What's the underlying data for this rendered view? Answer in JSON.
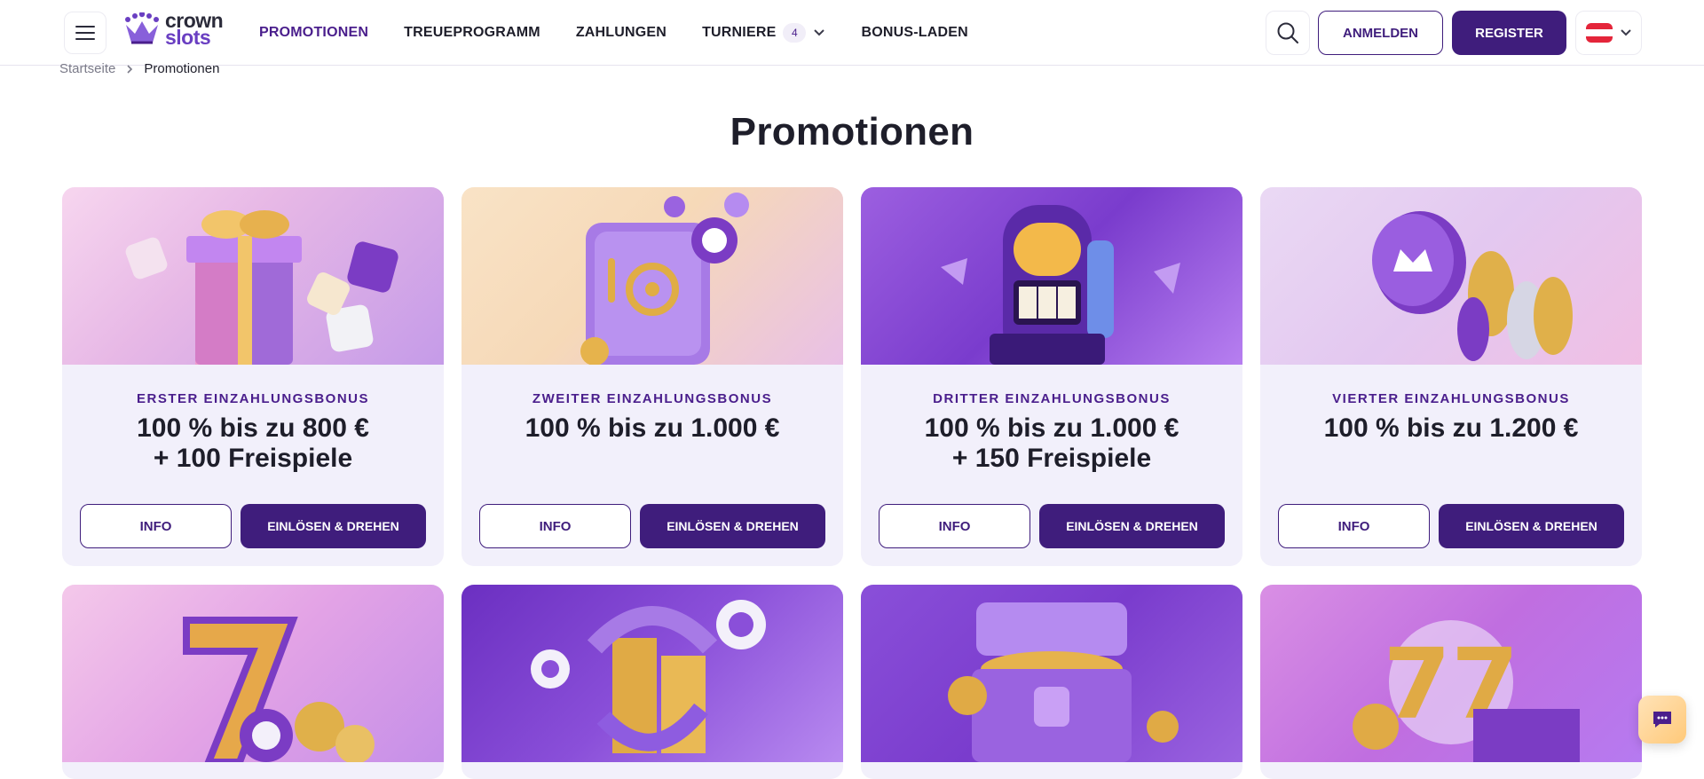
{
  "header": {
    "menu_icon": "hamburger-icon",
    "logo": {
      "line1": "crown",
      "line2": "slots"
    },
    "nav": [
      {
        "label": "PROMOTIONEN",
        "active": true
      },
      {
        "label": "TREUEPROGRAMM"
      },
      {
        "label": "ZAHLUNGEN"
      },
      {
        "label": "TURNIERE",
        "badge": "4"
      },
      {
        "label": "BONUS-LADEN"
      }
    ],
    "search_icon": "search-icon",
    "login_label": "ANMELDEN",
    "register_label": "REGISTER",
    "language_flag": "austria-flag-icon"
  },
  "breadcrumb": {
    "home": "Startseite",
    "current": "Promotionen"
  },
  "page_title": "Promotionen",
  "promotions": [
    {
      "title": "ERSTER EINZAHLUNGSBONUS",
      "offer_line1": "100 % bis zu 800 €",
      "offer_line2": "+ 100 Freispiele",
      "info_label": "INFO",
      "redeem_label": "EINLÖSEN & DREHEN",
      "image": "gift-box-dice"
    },
    {
      "title": "ZWEITER EINZAHLUNGSBONUS",
      "offer_line1": "100 % bis zu 1.000 €",
      "offer_line2": "",
      "info_label": "INFO",
      "redeem_label": "EINLÖSEN & DREHEN",
      "image": "safe-chips"
    },
    {
      "title": "DRITTER EINZAHLUNGSBONUS",
      "offer_line1": "100 % bis zu 1.000 €",
      "offer_line2": "+ 150 Freispiele",
      "info_label": "INFO",
      "redeem_label": "EINLÖSEN & DREHEN",
      "image": "slot-machine"
    },
    {
      "title": "VIERTER EINZAHLUNGSBONUS",
      "offer_line1": "100 % bis zu 1.200 €",
      "offer_line2": "",
      "info_label": "INFO",
      "redeem_label": "EINLÖSEN & DREHEN",
      "image": "crown-chips"
    }
  ],
  "promotions_row2_images": [
    "lucky-seven-coins",
    "coin-stack-arrows",
    "treasure-chest",
    "triple-seven-chips"
  ],
  "chat_icon": "chat-icon",
  "colors": {
    "brand": "#3f1d7c",
    "accent": "#6a3fc2",
    "card_bg": "#f2f0fb"
  }
}
